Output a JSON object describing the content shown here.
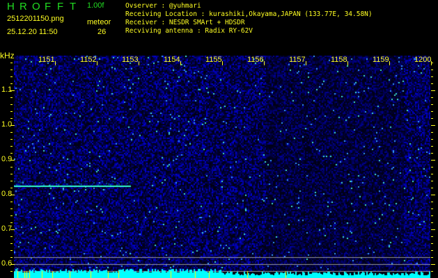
{
  "header": {
    "app_title": [
      "H",
      "R",
      "O",
      "F",
      "F",
      "T"
    ],
    "version": "1.00f",
    "filename": "2512201150.png",
    "datetime": "25.12.20 11:50",
    "meteor_label": "meteor",
    "meteor_count": "26"
  },
  "info": [
    {
      "label": "Ovserver           ",
      "value": ": @yuhmari"
    },
    {
      "label": "Receiving Location ",
      "value": ": kurashiki,Okayama,JAPAN (133.77E, 34.58N)"
    },
    {
      "label": "Receiver           ",
      "value": ": NESDR SMArt + HDSDR"
    },
    {
      "label": "Recviving antenna  ",
      "value": ": Radix RY-62V"
    }
  ],
  "axes": {
    "y_unit": "kHz",
    "x_ticks": [
      "1151",
      "1152",
      "1153",
      "1154",
      "1155",
      "1156",
      "1157",
      "1158",
      "1159",
      "1200"
    ],
    "y_ticks": [
      "1.1",
      "1.0",
      "0.9",
      "0.8",
      "0.7",
      "0.6"
    ]
  },
  "colors": {
    "title": "#22dd22",
    "text": "#ffff22",
    "background": "#000000",
    "signal": "#00ffff"
  }
}
